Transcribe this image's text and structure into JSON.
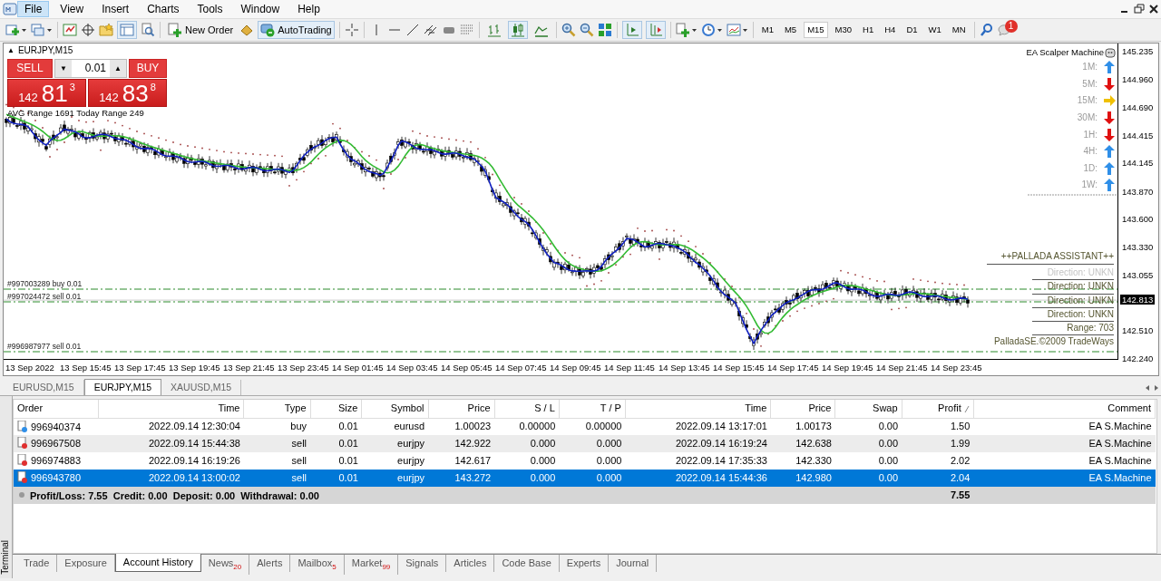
{
  "menu": [
    {
      "label": "File",
      "selected": true
    },
    {
      "label": "View",
      "selected": false
    },
    {
      "label": "Insert",
      "selected": false
    },
    {
      "label": "Charts",
      "selected": false
    },
    {
      "label": "Tools",
      "selected": false
    },
    {
      "label": "Window",
      "selected": false
    },
    {
      "label": "Help",
      "selected": false
    }
  ],
  "toolbar": {
    "new_order": "New Order",
    "autotrading": {
      "label": "AutoTrading",
      "on": true
    },
    "chart_types": [
      {
        "kind": "bars",
        "selected": false
      },
      {
        "kind": "candles",
        "selected": true
      },
      {
        "kind": "line",
        "selected": false
      }
    ],
    "auto_scroll": true,
    "chart_shift": true,
    "timeframes": [
      {
        "label": "M1",
        "selected": false
      },
      {
        "label": "M5",
        "selected": false
      },
      {
        "label": "M15",
        "selected": true
      },
      {
        "label": "M30",
        "selected": false
      },
      {
        "label": "H1",
        "selected": false
      },
      {
        "label": "H4",
        "selected": false
      },
      {
        "label": "D1",
        "selected": false
      },
      {
        "label": "W1",
        "selected": false
      },
      {
        "label": "MN",
        "selected": false
      }
    ],
    "notifications": "1"
  },
  "chart": {
    "title_glyph": "▲",
    "symbol": "EURJPY,M15",
    "one_click": {
      "sell": "SELL",
      "buy": "BUY",
      "lot_down": "▼",
      "lot": "0.01",
      "lot_up": "▲",
      "sell_price": {
        "head": "142",
        "big": "81",
        "tail": "3"
      },
      "buy_price": {
        "head": "142",
        "big": "83",
        "tail": "8"
      }
    },
    "range_text": "AVG Range 1691 Today Range 249",
    "ea_panel": {
      "title": "EA Scalper Machine",
      "signals": [
        {
          "label": "1M:",
          "kind": "up"
        },
        {
          "label": "5M:",
          "kind": "down"
        },
        {
          "label": "15M:",
          "kind": "right"
        },
        {
          "label": "30M:",
          "kind": "down"
        },
        {
          "label": "1H:",
          "kind": "down"
        },
        {
          "label": "4H:",
          "kind": "up"
        },
        {
          "label": "1D:",
          "kind": "up"
        },
        {
          "label": "1W:",
          "kind": "up"
        }
      ]
    },
    "pallada": {
      "title": "++PALLADA ASSISTANT++",
      "lines": [
        {
          "text": "Direction: UNKN",
          "muted": true
        },
        {
          "text": "Direction: UNKN",
          "muted": false
        },
        {
          "text": "Direction: UNKN",
          "muted": false
        },
        {
          "text": "Direction: UNKN",
          "muted": false
        },
        {
          "text": "Range: 703",
          "muted": false
        },
        {
          "text": "PalladaSE.©2009 TradeWays",
          "muted": false
        }
      ]
    },
    "orders": [
      "#997003289 buy 0.01",
      "#997024472 sell 0.01",
      "#996987977 sell 0.01"
    ],
    "price_axis": [
      "145.235",
      "144.960",
      "144.690",
      "144.415",
      "144.145",
      "143.870",
      "143.600",
      "143.330",
      "143.055",
      "142.510",
      "142.240"
    ],
    "current_price": "142.813",
    "time_axis": [
      "13 Sep 2022",
      "13 Sep 15:45",
      "13 Sep 17:45",
      "13 Sep 19:45",
      "13 Sep 21:45",
      "13 Sep 23:45",
      "14 Sep 01:45",
      "14 Sep 03:45",
      "14 Sep 05:45",
      "14 Sep 07:45",
      "14 Sep 09:45",
      "14 Sep 11:45",
      "14 Sep 13:45",
      "14 Sep 15:45",
      "14 Sep 17:45",
      "14 Sep 19:45",
      "14 Sep 21:45",
      "14 Sep 23:45"
    ]
  },
  "chart_tabs": [
    {
      "label": "EURUSD,M15",
      "selected": false
    },
    {
      "label": "EURJPY,M15",
      "selected": true
    },
    {
      "label": "XAUUSD,M15",
      "selected": false
    }
  ],
  "terminal": {
    "label": "Terminal",
    "columns": [
      "Order",
      "Time",
      "Type",
      "Size",
      "Symbol",
      "Price",
      "S / L",
      "T / P",
      "Time",
      "Price",
      "Swap",
      "Profit",
      "Comment"
    ],
    "rows": [
      {
        "kind": "buy",
        "selected": false,
        "cells": [
          "996940374",
          "2022.09.14 12:30:04",
          "buy",
          "0.01",
          "eurusd",
          "1.00023",
          "0.00000",
          "0.00000",
          "2022.09.14 13:17:01",
          "1.00173",
          "0.00",
          "1.50",
          "EA S.Machine"
        ]
      },
      {
        "kind": "sell",
        "selected": false,
        "cells": [
          "996967508",
          "2022.09.14 15:44:38",
          "sell",
          "0.01",
          "eurjpy",
          "142.922",
          "0.000",
          "0.000",
          "2022.09.14 16:19:24",
          "142.638",
          "0.00",
          "1.99",
          "EA S.Machine"
        ]
      },
      {
        "kind": "sell",
        "selected": false,
        "cells": [
          "996974883",
          "2022.09.14 16:19:26",
          "sell",
          "0.01",
          "eurjpy",
          "142.617",
          "0.000",
          "0.000",
          "2022.09.14 17:35:33",
          "142.330",
          "0.00",
          "2.02",
          "EA S.Machine"
        ]
      },
      {
        "kind": "sell",
        "selected": true,
        "cells": [
          "996943780",
          "2022.09.14 13:00:02",
          "sell",
          "0.01",
          "eurjpy",
          "143.272",
          "0.000",
          "0.000",
          "2022.09.14 15:44:36",
          "142.980",
          "0.00",
          "2.04",
          "EA S.Machine"
        ]
      }
    ],
    "summary": {
      "text": "Profit/Loss: 7.55  Credit: 0.00  Deposit: 0.00  Withdrawal: 0.00",
      "total": "7.55"
    },
    "tabs": [
      {
        "label": "Trade",
        "selected": false
      },
      {
        "label": "Exposure",
        "selected": false
      },
      {
        "label": "Account History",
        "selected": true
      },
      {
        "label": "News",
        "count": "20",
        "selected": false
      },
      {
        "label": "Alerts",
        "selected": false
      },
      {
        "label": "Mailbox",
        "count": "5",
        "selected": false
      },
      {
        "label": "Market",
        "count": "99",
        "selected": false
      },
      {
        "label": "Signals",
        "selected": false
      },
      {
        "label": "Articles",
        "selected": false
      },
      {
        "label": "Code Base",
        "selected": false
      },
      {
        "label": "Experts",
        "selected": false
      },
      {
        "label": "Journal",
        "selected": false
      }
    ]
  }
}
